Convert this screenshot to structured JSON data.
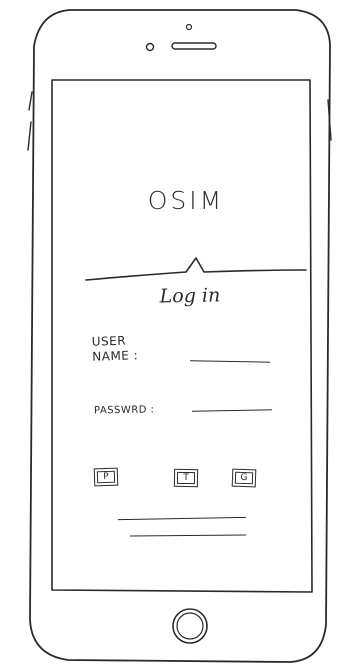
{
  "app": {
    "title": "OSIM"
  },
  "login": {
    "heading": "Log in",
    "username_label_line1": "USER",
    "username_label_line2": "NAME :",
    "password_label": "PASSWRD :",
    "username_value": "",
    "password_value": ""
  },
  "social_buttons": [
    {
      "label": "P",
      "icon": "p-icon"
    },
    {
      "label": "T",
      "icon": "t-icon"
    },
    {
      "label": "G",
      "icon": "g-icon"
    }
  ],
  "colors": {
    "ink": "#2a2a2a",
    "paper": "#ffffff"
  }
}
